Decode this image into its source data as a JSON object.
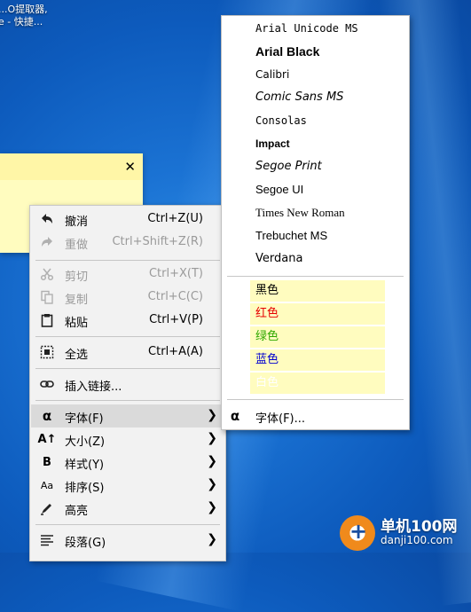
{
  "desktop": {
    "label_line1": "...O提取器,",
    "label_line2": "e - 快捷..."
  },
  "sticky_note": {
    "close_glyph": "✕",
    "color": "#fffcbf"
  },
  "context_menu": {
    "items": [
      {
        "icon": "undo-icon",
        "label": "撤消",
        "shortcut": "Ctrl+Z(U)",
        "enabled": true
      },
      {
        "icon": "redo-icon",
        "label": "重做",
        "shortcut": "Ctrl+Shift+Z(R)",
        "enabled": false
      },
      {
        "icon": "scissors-icon",
        "label": "剪切",
        "shortcut": "Ctrl+X(T)",
        "enabled": false
      },
      {
        "icon": "copy-icon",
        "label": "复制",
        "shortcut": "Ctrl+C(C)",
        "enabled": false
      },
      {
        "icon": "clipboard-icon",
        "label": "粘贴",
        "shortcut": "Ctrl+V(P)",
        "enabled": true
      },
      {
        "icon": "select-all-icon",
        "label": "全选",
        "shortcut": "Ctrl+A(A)",
        "enabled": true
      },
      {
        "icon": "link-icon",
        "label": "插入链接...",
        "shortcut": "",
        "enabled": true
      },
      {
        "icon": "alpha-icon",
        "label": "字体(F)",
        "submenu": true,
        "highlighted": true
      },
      {
        "icon": "text-size-icon",
        "label": "大小(Z)",
        "submenu": true
      },
      {
        "icon": "bold-icon",
        "label": "样式(Y)",
        "submenu": true
      },
      {
        "icon": "sort-icon",
        "label": "排序(S)",
        "submenu": true
      },
      {
        "icon": "highlighter-icon",
        "label": "高亮",
        "submenu": true
      },
      {
        "icon": "paragraph-icon",
        "label": "段落(G)",
        "submenu": true
      }
    ]
  },
  "font_submenu": {
    "fonts": [
      "Arial Unicode MS",
      "Arial Black",
      "Calibri",
      "Comic Sans MS",
      "Consolas",
      "Impact",
      "Segoe Print",
      "Segoe UI",
      "Times New Roman",
      "Trebuchet MS",
      "Verdana"
    ],
    "colors": [
      {
        "label": "黑色",
        "color": "#000000"
      },
      {
        "label": "红色",
        "color": "#e60000"
      },
      {
        "label": "绿色",
        "color": "#2ea800"
      },
      {
        "label": "蓝色",
        "color": "#0000d0"
      },
      {
        "label": "白色",
        "color": "#ffffff"
      }
    ],
    "more_fonts_icon": "alpha-icon",
    "more_fonts_label": "字体(F)..."
  },
  "watermark": {
    "text_cn": "单机100网",
    "text_en": "danji100.com"
  }
}
